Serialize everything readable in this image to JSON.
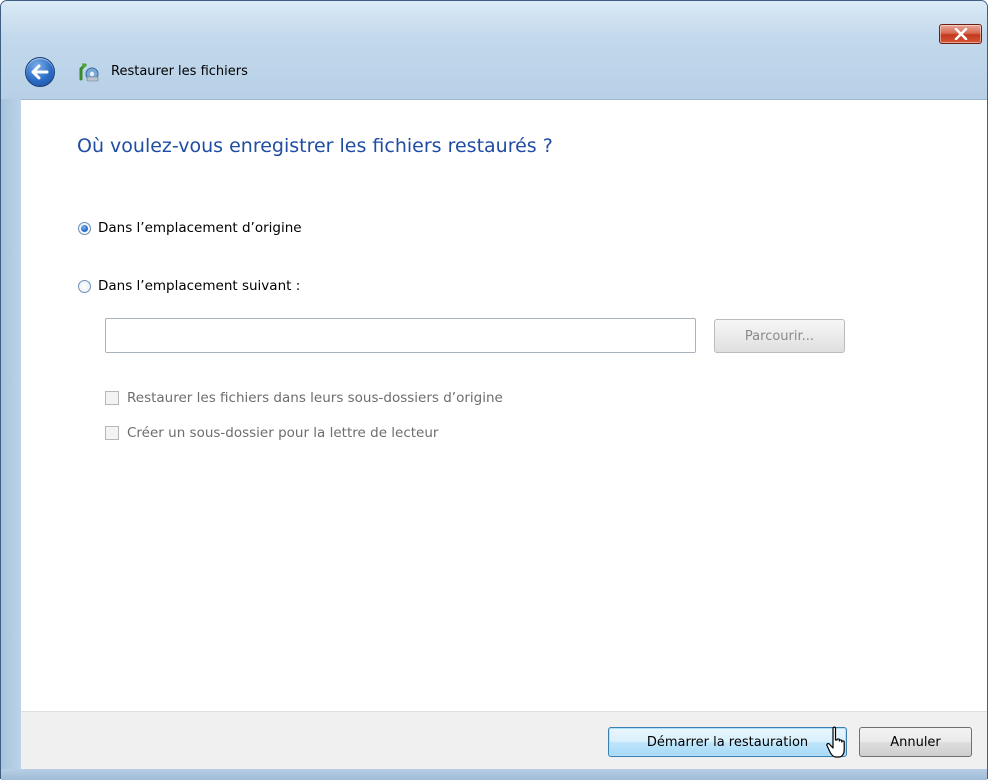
{
  "window": {
    "title": "Restaurer les fichiers"
  },
  "main": {
    "heading": "Où voulez-vous enregistrer les fichiers restaurés ?",
    "options": [
      {
        "label": "Dans l’emplacement d’origine",
        "selected": true
      },
      {
        "label": "Dans l’emplacement suivant :",
        "selected": false
      }
    ],
    "path_input": {
      "value": "",
      "placeholder": ""
    },
    "browse_label": "Parcourir...",
    "checkboxes": [
      {
        "label": "Restaurer les fichiers dans leurs sous-dossiers d’origine",
        "checked": false,
        "enabled": false
      },
      {
        "label": "Créer un sous-dossier pour la lettre de lecteur",
        "checked": false,
        "enabled": false
      }
    ]
  },
  "footer": {
    "start_label": "Démarrer la restauration",
    "cancel_label": "Annuler"
  },
  "colors": {
    "heading": "#1f4da3",
    "close_button": "#c3391c",
    "disabled_text": "#6d6d6d"
  },
  "icons": [
    "close-icon",
    "back-arrow-icon",
    "restore-files-icon",
    "mouse-cursor-icon"
  ]
}
